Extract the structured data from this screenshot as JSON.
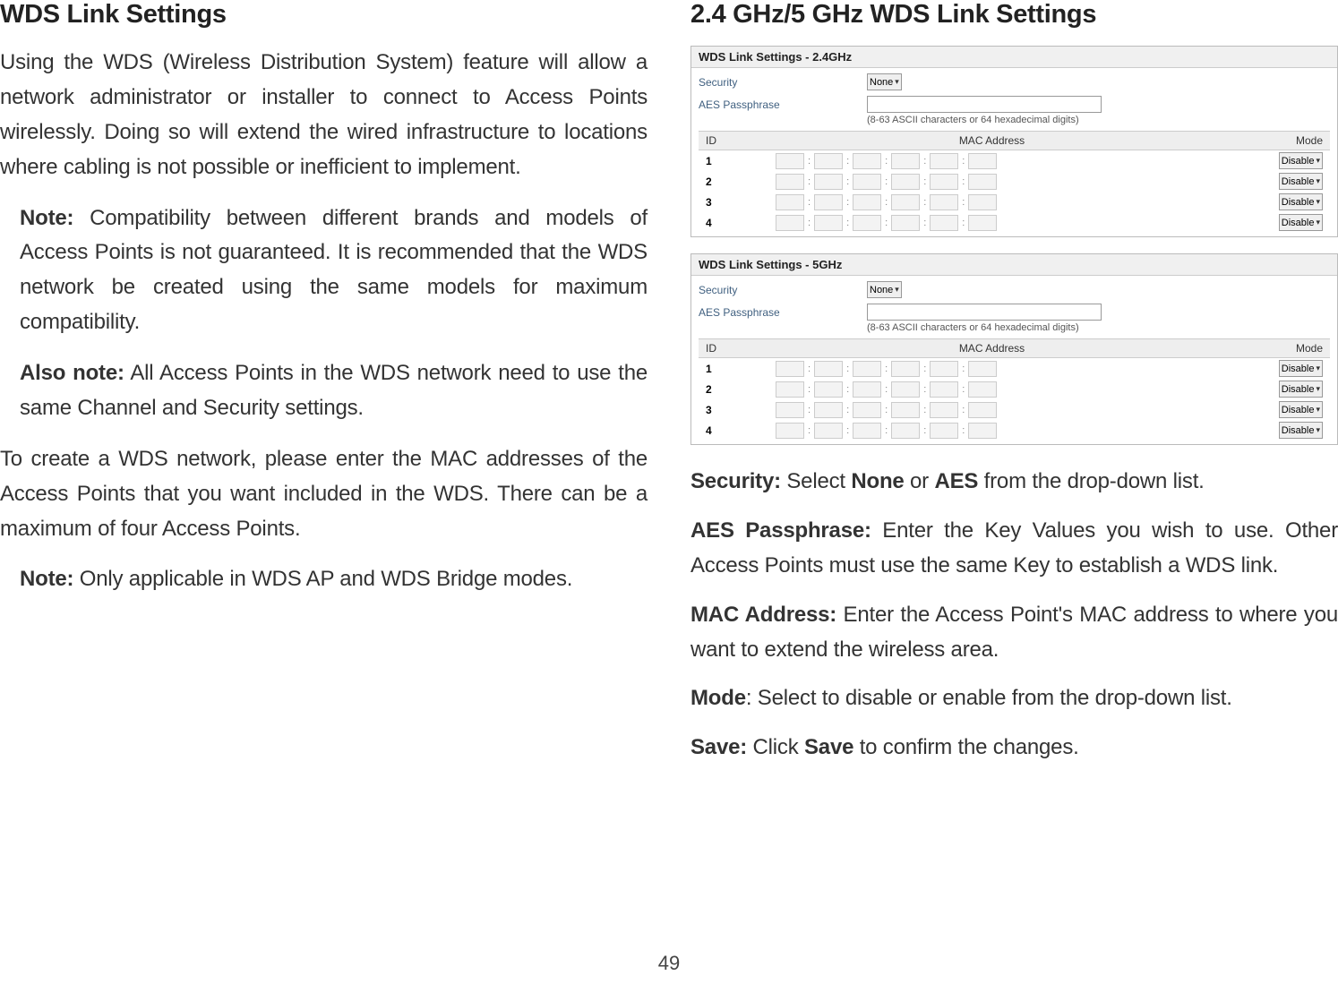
{
  "left": {
    "heading": "WDS Link Settings",
    "intro": "Using the WDS (Wireless Distribution System) feature will allow a network administrator or installer to connect to Access Points wirelessly. Doing so will extend the wired infrastructure to locations where cabling is not possible or inefficient to implement.",
    "note1_label": "Note:",
    "note1_body": " Compatibility between different brands and models of Access Points is not guaranteed. It is recommended that the WDS network be created using the same models for maximum compatibility.",
    "note2_label": "Also note:",
    "note2_body": " All Access Points in the WDS network need to use the same Channel and Security settings.",
    "para2": "To create a WDS network, please enter the MAC addresses of the Access Points that you want included in the WDS. There can be a maximum of four Access Points.",
    "note3_label": "Note:",
    "note3_body": " Only applicable in WDS AP and WDS Bridge modes."
  },
  "right": {
    "heading": "2.4 GHz/5 GHz WDS Link Settings",
    "panels": [
      {
        "title": "WDS Link Settings - 2.4GHz",
        "security_label": "Security",
        "security_value": "None",
        "aes_label": "AES Passphrase",
        "hint": "(8-63 ASCII characters or 64 hexadecimal digits)",
        "cols": {
          "id": "ID",
          "mac": "MAC Address",
          "mode": "Mode"
        },
        "rows": [
          {
            "id": "1",
            "mode": "Disable"
          },
          {
            "id": "2",
            "mode": "Disable"
          },
          {
            "id": "3",
            "mode": "Disable"
          },
          {
            "id": "4",
            "mode": "Disable"
          }
        ]
      },
      {
        "title": "WDS Link Settings - 5GHz",
        "security_label": "Security",
        "security_value": "None",
        "aes_label": "AES Passphrase",
        "hint": "(8-63 ASCII characters or 64 hexadecimal digits)",
        "cols": {
          "id": "ID",
          "mac": "MAC Address",
          "mode": "Mode"
        },
        "rows": [
          {
            "id": "1",
            "mode": "Disable"
          },
          {
            "id": "2",
            "mode": "Disable"
          },
          {
            "id": "3",
            "mode": "Disable"
          },
          {
            "id": "4",
            "mode": "Disable"
          }
        ]
      }
    ],
    "desc": {
      "security_label": "Security:",
      "security_body": " Select ",
      "security_opt1": "None",
      "security_mid": " or ",
      "security_opt2": "AES",
      "security_tail": " from the drop-down list.",
      "aes_label": "AES Passphrase:",
      "aes_body": " Enter the Key Values you wish to use. Other Access Points must use the same Key to establish a WDS link.",
      "mac_label": "MAC Address:",
      "mac_body": " Enter the Access Point's MAC address to where you want to extend the wireless area.",
      "mode_label": "Mode",
      "mode_body": ": Select to disable or enable from the drop-down list.",
      "save_label": "Save:",
      "save_body": " Click ",
      "save_btn": "Save",
      "save_tail": " to confirm the changes."
    }
  },
  "page_number": "49"
}
